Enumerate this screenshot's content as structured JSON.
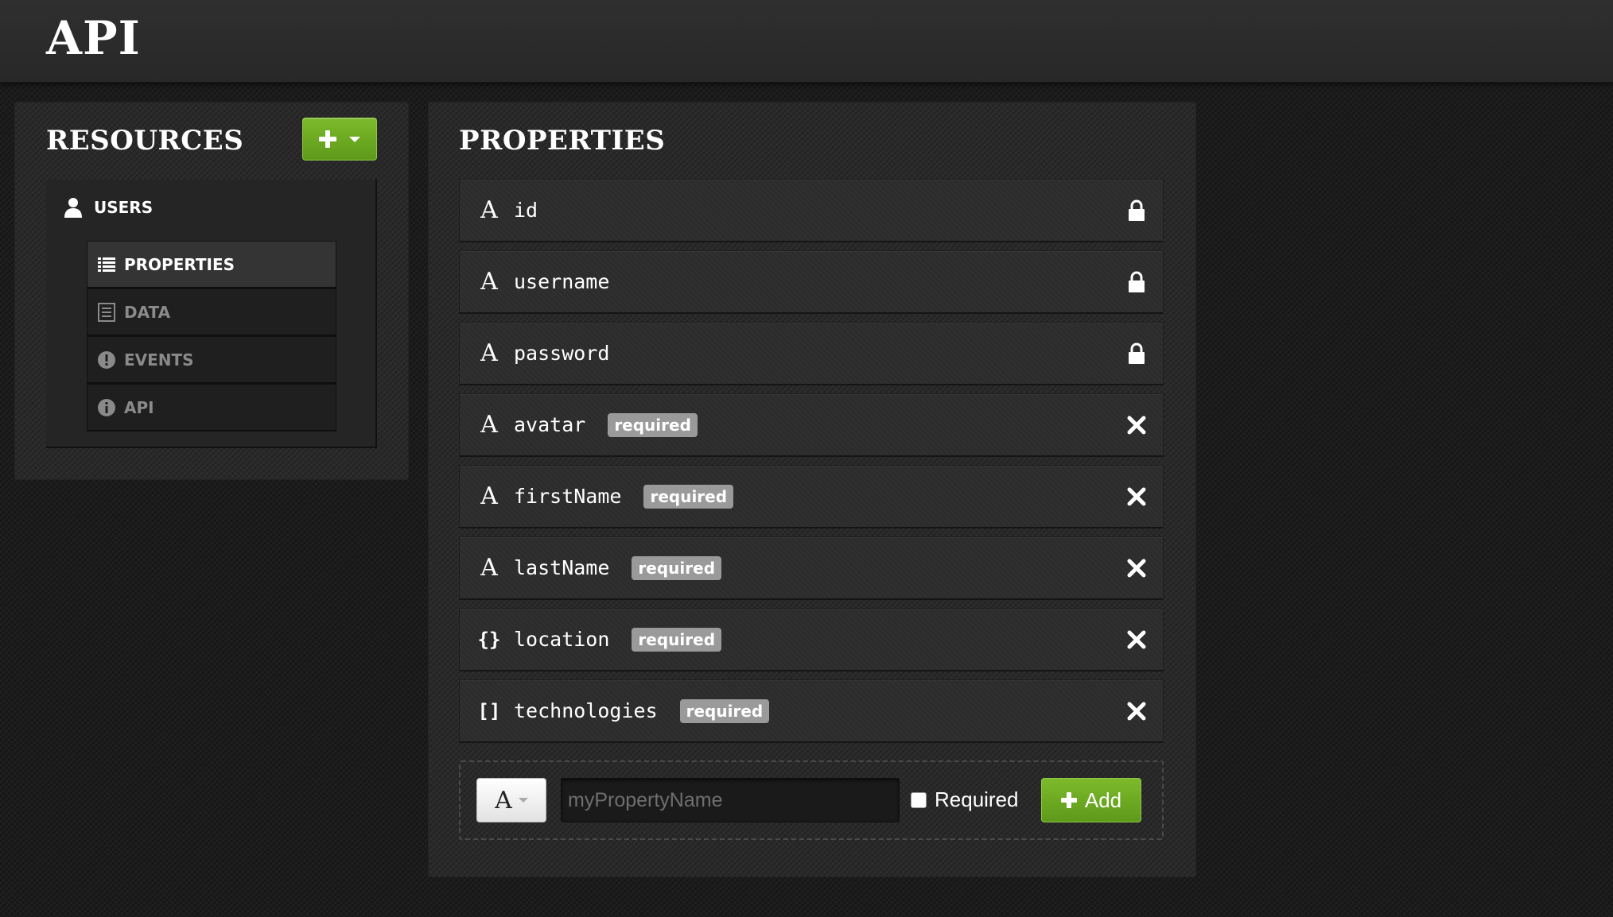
{
  "header": {
    "title": "API"
  },
  "resources": {
    "heading": "RESOURCES",
    "add_button_icon": "plus-icon",
    "items": [
      {
        "label": "USERS",
        "icon": "user-icon",
        "sub_items": [
          {
            "label": "PROPERTIES",
            "icon": "list-icon",
            "active": true
          },
          {
            "label": "DATA",
            "icon": "table-icon",
            "active": false
          },
          {
            "label": "EVENTS",
            "icon": "exclamation-icon",
            "active": false
          },
          {
            "label": "API",
            "icon": "info-icon",
            "active": false
          }
        ]
      }
    ]
  },
  "properties": {
    "heading": "PROPERTIES",
    "required_label": "required",
    "rows": [
      {
        "type_glyph": "A",
        "type": "string",
        "name": "id",
        "required": false,
        "action": "lock-icon"
      },
      {
        "type_glyph": "A",
        "type": "string",
        "name": "username",
        "required": false,
        "action": "lock-icon"
      },
      {
        "type_glyph": "A",
        "type": "string",
        "name": "password",
        "required": false,
        "action": "lock-icon"
      },
      {
        "type_glyph": "A",
        "type": "string",
        "name": "avatar",
        "required": true,
        "action": "close-icon"
      },
      {
        "type_glyph": "A",
        "type": "string",
        "name": "firstName",
        "required": true,
        "action": "close-icon"
      },
      {
        "type_glyph": "A",
        "type": "string",
        "name": "lastName",
        "required": true,
        "action": "close-icon"
      },
      {
        "type_glyph": "{}",
        "type": "object",
        "name": "location",
        "required": true,
        "action": "close-icon"
      },
      {
        "type_glyph": "[]",
        "type": "array",
        "name": "technologies",
        "required": true,
        "action": "close-icon"
      }
    ]
  },
  "new_property": {
    "type_glyph": "A",
    "name_placeholder": "myPropertyName",
    "required_label": "Required",
    "add_label": "Add"
  },
  "colors": {
    "accent_green": "#6cad22",
    "badge_gray": "#9a9a9a",
    "background": "#1c1c1c"
  }
}
